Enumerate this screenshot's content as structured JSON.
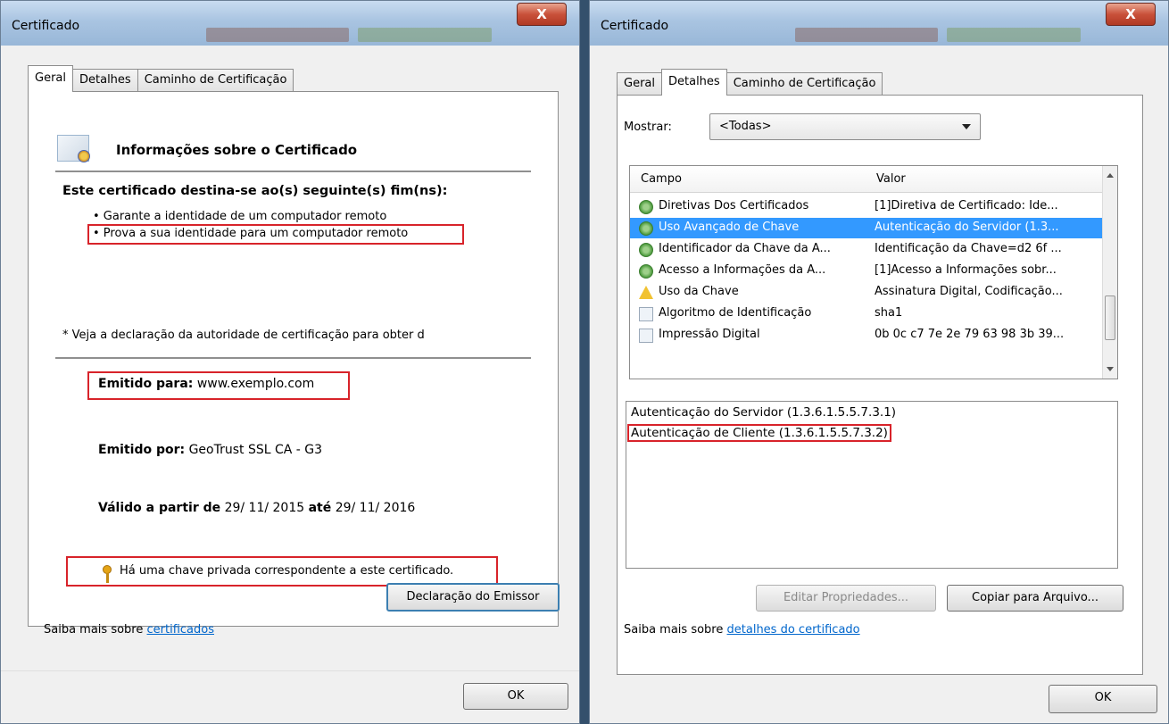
{
  "left": {
    "title": "Certificado",
    "close": "X",
    "tabs": [
      "Geral",
      "Detalhes",
      "Caminho de Certificação"
    ],
    "heading": "Informações sobre o Certificado",
    "purpose_heading": "Este certificado destina-se ao(s) seguinte(s) fim(ns):",
    "purposes": [
      "• Garante a identidade de um computador remoto",
      "• Prova a sua identidade para um computador remoto"
    ],
    "note": "* Veja a declaração da autoridade de certificação para obter d",
    "issued_to_label": "Emitido para:",
    "issued_to": "www.exemplo.com",
    "issued_by_label": "Emitido por:",
    "issued_by": "GeoTrust SSL CA - G3",
    "valid_from_label": "Válido a partir de",
    "valid_from": "29/ 11/ 2015",
    "valid_to_label": "até",
    "valid_to": "29/ 11/ 2016",
    "private_key": "Há uma chave privada correspondente a este certificado.",
    "issuer_button": "Declaração do Emissor",
    "learn_prefix": "Saiba mais sobre",
    "learn_link": "certificados",
    "ok": "OK"
  },
  "right": {
    "title": "Certificado",
    "close": "X",
    "tabs": [
      "Geral",
      "Detalhes",
      "Caminho de Certificação"
    ],
    "show_label": "Mostrar:",
    "show_value": "<Todas>",
    "columns": [
      "Campo",
      "Valor"
    ],
    "rows": [
      {
        "field": "Diretivas Dos Certificados",
        "value": "[1]Diretiva de Certificado: Ide...",
        "icon": "ext"
      },
      {
        "field": "Uso Avançado de Chave",
        "value": "Autenticação do Servidor (1.3...",
        "icon": "ext"
      },
      {
        "field": "Identificador da Chave da A...",
        "value": "Identificação da Chave=d2 6f ...",
        "icon": "ext"
      },
      {
        "field": "Acesso a Informações da A...",
        "value": "[1]Acesso a Informações sobr...",
        "icon": "ext"
      },
      {
        "field": "Uso da Chave",
        "value": "Assinatura Digital, Codificação...",
        "icon": "warn"
      },
      {
        "field": "Algoritmo de Identificação",
        "value": "sha1",
        "icon": "doc"
      },
      {
        "field": "Impressão Digital",
        "value": "0b 0c c7 7e 2e 79 63 98 3b 39...",
        "icon": "doc"
      }
    ],
    "selected_row": 1,
    "details": [
      "Autenticação do Servidor (1.3.6.1.5.5.7.3.1)",
      "Autenticação de Cliente (1.3.6.1.5.5.7.3.2)"
    ],
    "edit_button": "Editar Propriedades...",
    "copy_button": "Copiar para Arquivo...",
    "learn_prefix": "Saiba mais sobre",
    "learn_link": "detalhes do certificado",
    "ok": "OK"
  },
  "colors": {
    "highlight": "#d8232a",
    "selection": "#3399ff",
    "link": "#0066cc"
  }
}
